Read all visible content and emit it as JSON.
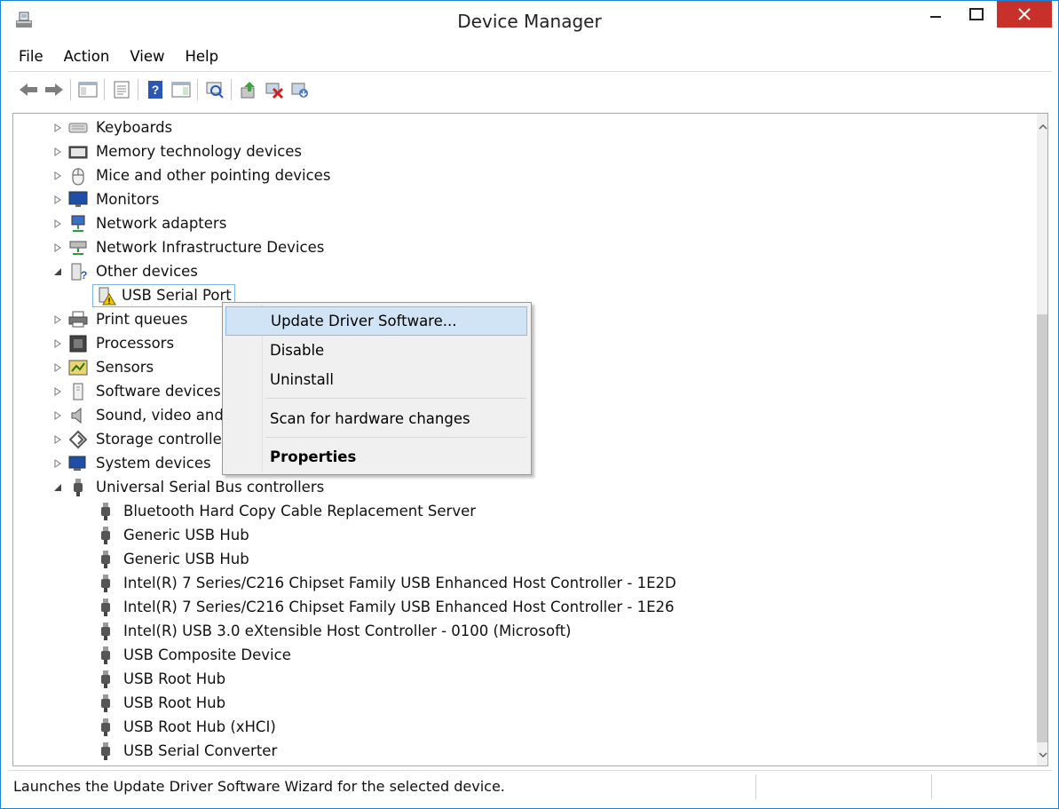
{
  "window": {
    "title": "Device Manager",
    "accent_color": "#1883d7",
    "close_color": "#c7312a"
  },
  "menu": {
    "file": "File",
    "action": "Action",
    "view": "View",
    "help": "Help"
  },
  "toolbar": {
    "buttons": [
      "back-icon",
      "forward-icon",
      "show-hide-console-tree-icon",
      "properties-icon",
      "help-icon",
      "action-pane-icon",
      "scan-hardware-icon",
      "update-driver-icon",
      "disable-device-icon",
      "uninstall-device-icon"
    ]
  },
  "tree": {
    "keyboards": "Keyboards",
    "memory": "Memory technology devices",
    "mice": "Mice and other pointing devices",
    "monitors": "Monitors",
    "network_adapters": "Network adapters",
    "network_infra": "Network Infrastructure Devices",
    "other_devices": "Other devices",
    "usb_serial_port": "USB Serial Port",
    "print_queues": "Print queues",
    "processors": "Processors",
    "sensors": "Sensors",
    "software_devices": "Software devices",
    "sound": "Sound, video and",
    "storage": "Storage controller",
    "system_devices": "System devices",
    "usb_controllers": "Universal Serial Bus controllers",
    "usb_children": [
      "Bluetooth Hard Copy Cable Replacement Server",
      "Generic USB Hub",
      "Generic USB Hub",
      "Intel(R) 7 Series/C216 Chipset Family USB Enhanced Host Controller - 1E2D",
      "Intel(R) 7 Series/C216 Chipset Family USB Enhanced Host Controller - 1E26",
      "Intel(R) USB 3.0 eXtensible Host Controller - 0100 (Microsoft)",
      "USB Composite Device",
      "USB Root Hub",
      "USB Root Hub",
      "USB Root Hub (xHCI)",
      "USB Serial Converter"
    ]
  },
  "context_menu": {
    "update_driver": "Update Driver Software...",
    "disable": "Disable",
    "uninstall": "Uninstall",
    "scan": "Scan for hardware changes",
    "properties": "Properties"
  },
  "status": {
    "text": "Launches the Update Driver Software Wizard for the selected device."
  }
}
